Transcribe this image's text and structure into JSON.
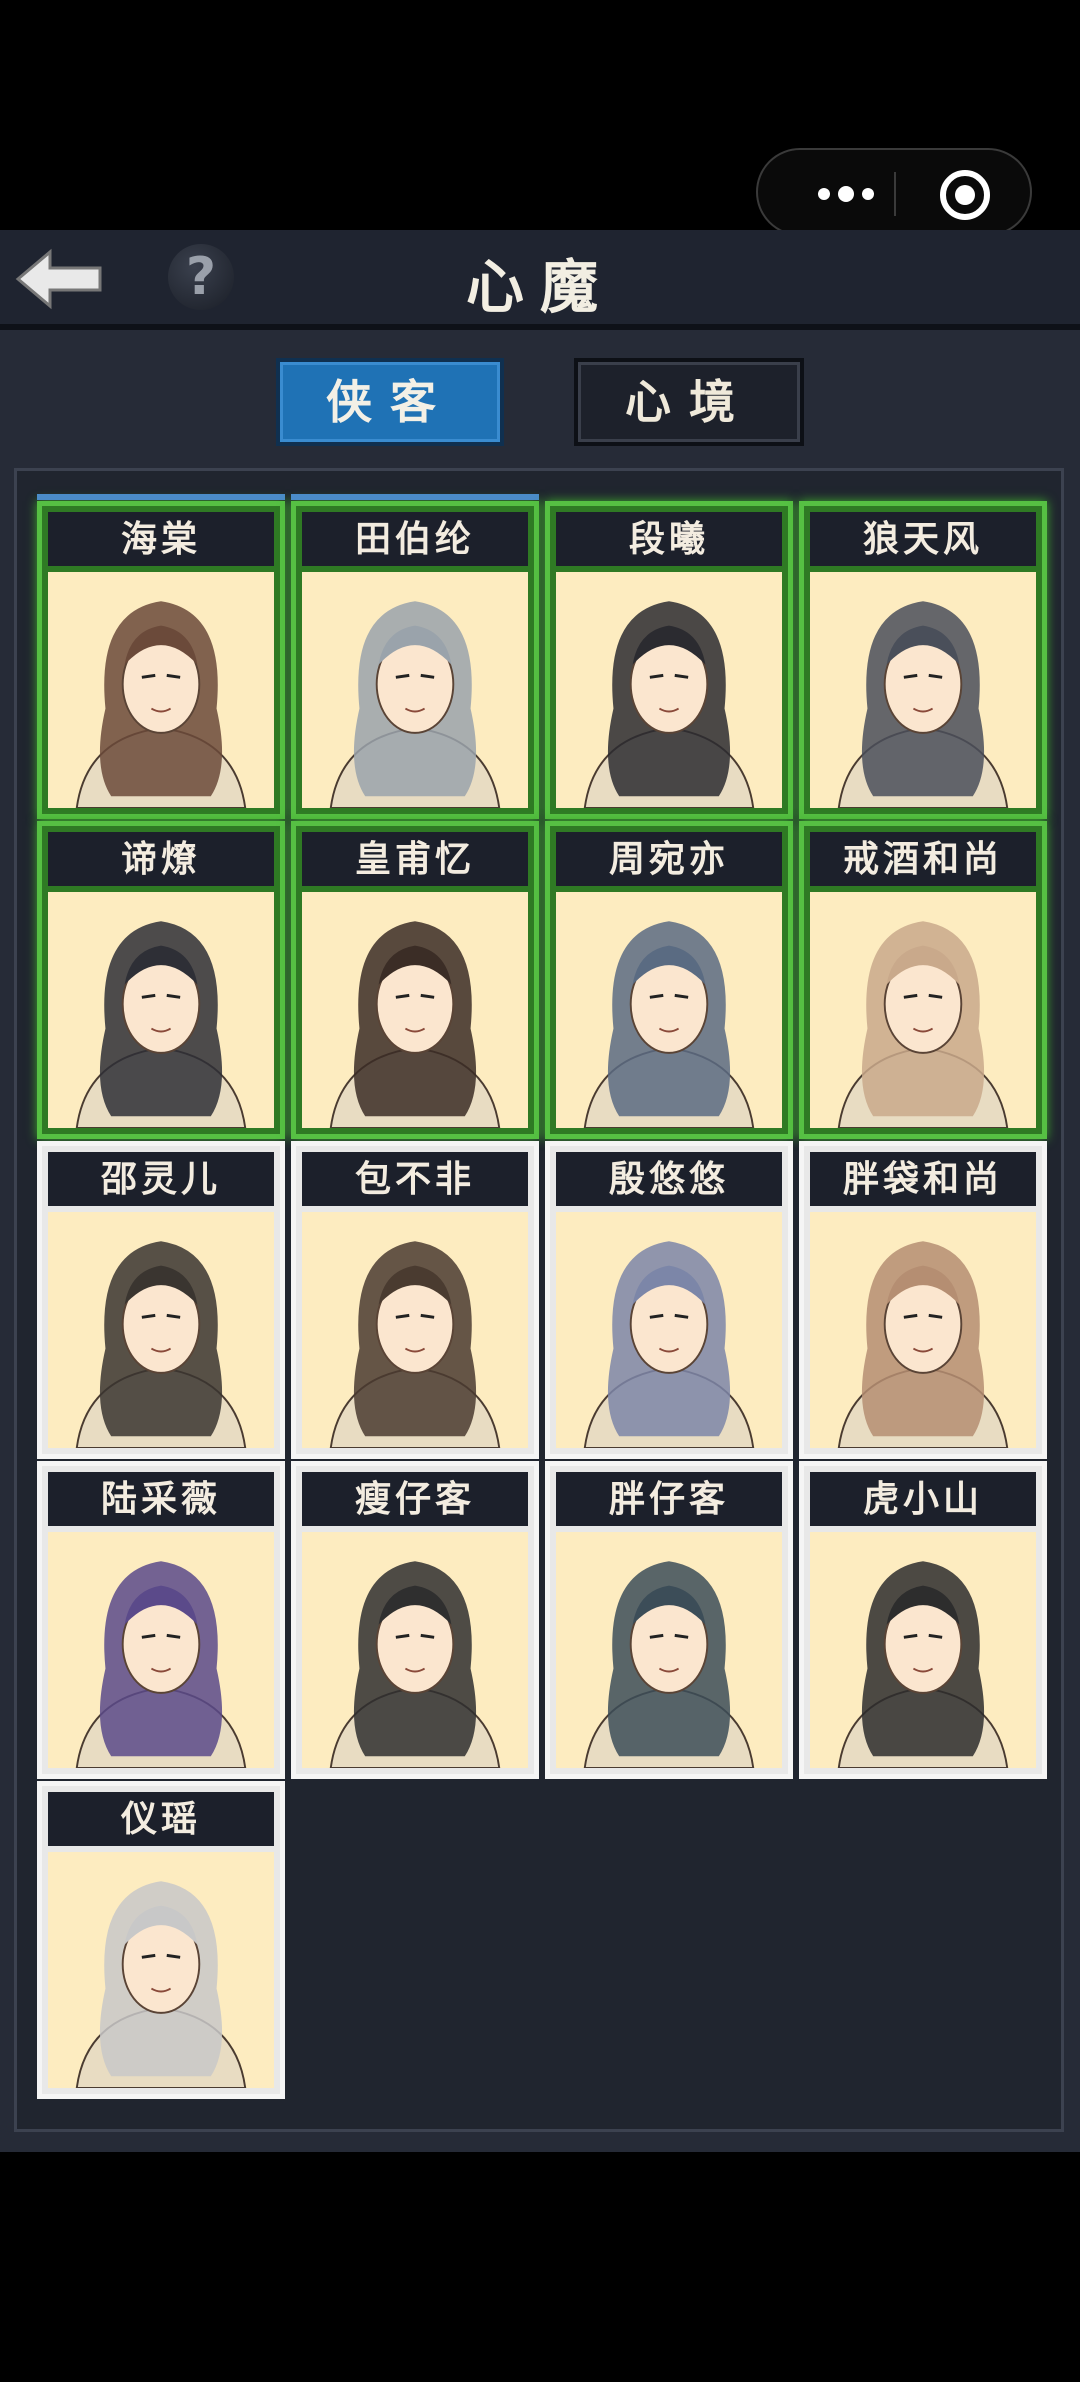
{
  "header": {
    "title": "心魔"
  },
  "tabs": [
    {
      "label": "侠客",
      "active": true
    },
    {
      "label": "心境",
      "active": false
    }
  ],
  "heroes": [
    {
      "name": "海棠",
      "unlocked": true
    },
    {
      "name": "田伯纶",
      "unlocked": true
    },
    {
      "name": "段曦",
      "unlocked": true
    },
    {
      "name": "狼天风",
      "unlocked": true
    },
    {
      "name": "谛燎",
      "unlocked": true
    },
    {
      "name": "皇甫忆",
      "unlocked": true
    },
    {
      "name": "周宛亦",
      "unlocked": true
    },
    {
      "name": "戒酒和尚",
      "unlocked": true
    },
    {
      "name": "邵灵儿",
      "unlocked": false
    },
    {
      "name": "包不非",
      "unlocked": false
    },
    {
      "name": "殷悠悠",
      "unlocked": false
    },
    {
      "name": "胖袋和尚",
      "unlocked": false
    },
    {
      "name": "陆采薇",
      "unlocked": false
    },
    {
      "name": "瘦仔客",
      "unlocked": false
    },
    {
      "name": "胖仔客",
      "unlocked": false
    },
    {
      "name": "虎小山",
      "unlocked": false
    },
    {
      "name": "仪瑶",
      "unlocked": false
    }
  ],
  "colors": {
    "unlocked_frame": "#56c043",
    "locked_frame": "#f5f5f5",
    "active_tab": "#1f72b5",
    "portrait_bg": "#fdecc0"
  },
  "icons": {
    "back": "back-arrow-icon",
    "help": "question-mark-icon",
    "more": "more-dots-icon",
    "close": "target-circle-icon"
  }
}
